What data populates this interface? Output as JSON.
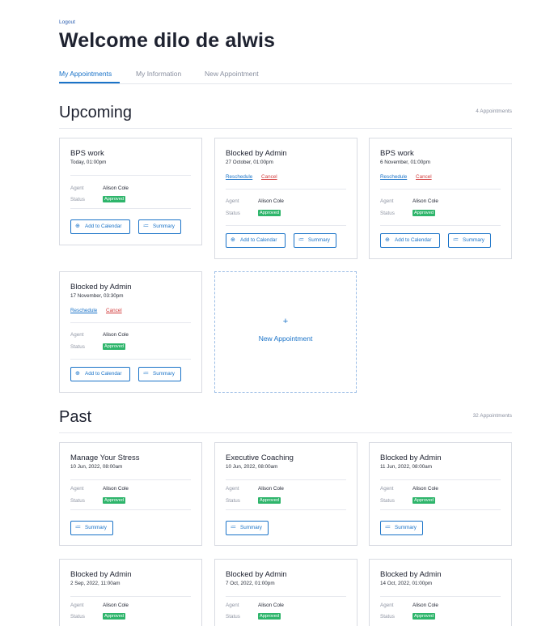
{
  "header": {
    "logout": "Logout",
    "welcome": "Welcome dilo de alwis"
  },
  "tabs": [
    {
      "label": "My Appointments",
      "active": true
    },
    {
      "label": "My Information",
      "active": false
    },
    {
      "label": "New Appointment",
      "active": false
    }
  ],
  "labels": {
    "agent": "Agent",
    "status": "Status",
    "add_to_calendar": "Add to Calendar",
    "summary": "Summary",
    "reschedule": "Reschedule",
    "cancel": "Cancel"
  },
  "icons": {
    "calendar": "calendar-plus-icon",
    "summary": "list-icon",
    "plus": "plus-icon"
  },
  "colors": {
    "accent": "#1a73c8",
    "danger": "#d23b3b",
    "approved": "#2eb56b"
  },
  "upcoming": {
    "title": "Upcoming",
    "count": "4 Appointments",
    "new_appointment": {
      "plus": "+",
      "label": "New Appointment"
    },
    "cards": [
      {
        "title": "BPS work",
        "when": "Today, 01:00pm",
        "agent": "Alison Cole",
        "status": "Approved"
      },
      {
        "title": "Blocked by Admin",
        "when": "27 October, 01:00pm",
        "agent": "Alison Cole",
        "status": "Approved"
      },
      {
        "title": "BPS work",
        "when": "6 November, 01:00pm",
        "agent": "Alison Cole",
        "status": "Approved"
      },
      {
        "title": "Blocked by Admin",
        "when": "17 November, 03:30pm",
        "agent": "Alison Cole",
        "status": "Approved"
      }
    ]
  },
  "past": {
    "title": "Past",
    "count": "32 Appointments",
    "cards": [
      {
        "title": "Manage Your Stress",
        "when": "10 Jun, 2022, 08:00am",
        "agent": "Alison Cole",
        "status": "Approved"
      },
      {
        "title": "Executive Coaching",
        "when": "10 Jun, 2022, 08:00am",
        "agent": "Alison Cole",
        "status": "Approved"
      },
      {
        "title": "Blocked by Admin",
        "when": "11 Jun, 2022, 08:00am",
        "agent": "Alison Cole",
        "status": "Approved"
      },
      {
        "title": "Blocked by Admin",
        "when": "2 Sep, 2022, 11:00am",
        "agent": "Alison Cole",
        "status": "Approved"
      },
      {
        "title": "Blocked by Admin",
        "when": "7 Oct, 2022, 01:00pm",
        "agent": "Alison Cole",
        "status": "Approved"
      },
      {
        "title": "Blocked by Admin",
        "when": "14 Oct, 2022, 01:00pm",
        "agent": "Alison Cole",
        "status": "Approved"
      }
    ]
  }
}
